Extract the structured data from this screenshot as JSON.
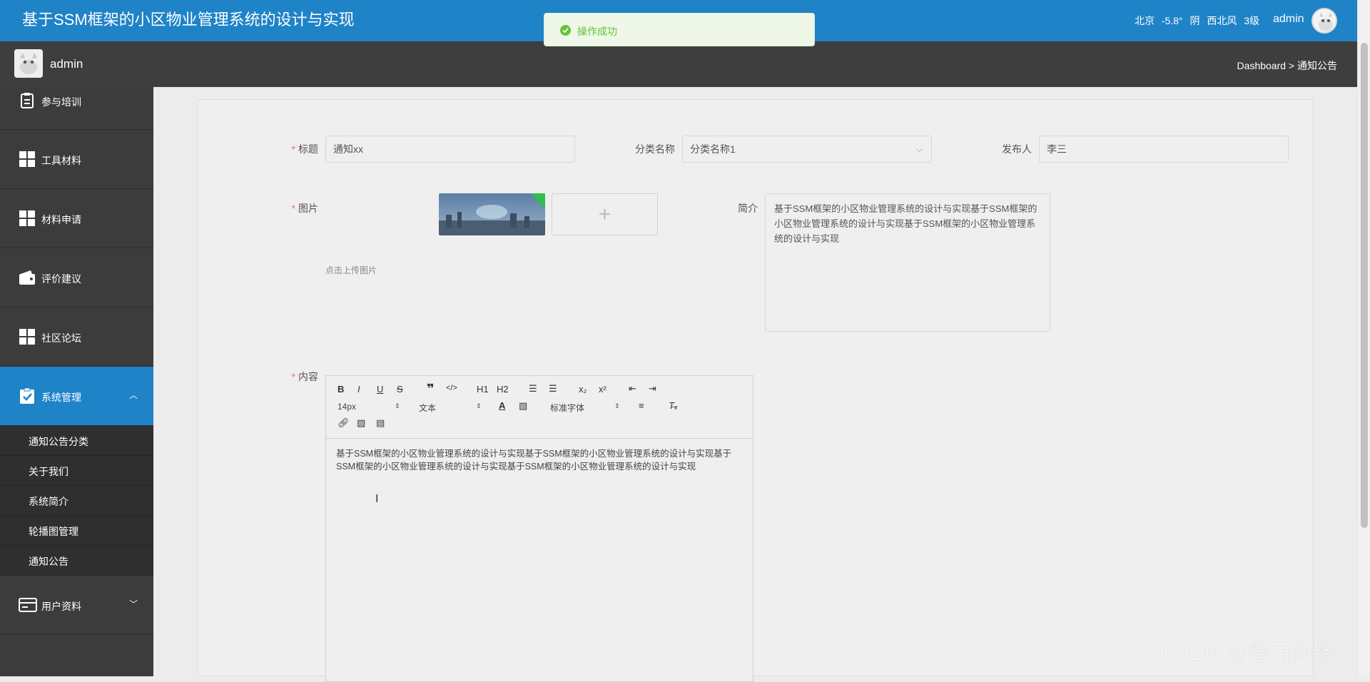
{
  "header": {
    "app_title": "基于SSM框架的小区物业管理系统的设计与实现",
    "weather": "北京  -5.8°  阴  西北风  3级",
    "username": "admin"
  },
  "subheader": {
    "username": "admin",
    "breadcrumb": "Dashboard > 通知公告"
  },
  "toast": {
    "message": "操作成功"
  },
  "sidebar": {
    "items": [
      {
        "label": "参与培训",
        "icon": "clipboard-icon"
      },
      {
        "label": "工具材料",
        "icon": "grid-icon"
      },
      {
        "label": "材料申请",
        "icon": "grid-icon"
      },
      {
        "label": "评价建议",
        "icon": "wallet-icon"
      },
      {
        "label": "社区论坛",
        "icon": "grid-icon"
      },
      {
        "label": "系统管理",
        "icon": "checklist-icon",
        "expanded": true,
        "active": true
      },
      {
        "label": "用户资料",
        "icon": "card-icon"
      }
    ],
    "submenu": [
      "通知公告分类",
      "关于我们",
      "系统简介",
      "轮播图管理",
      "通知公告"
    ]
  },
  "form": {
    "title_label": "标题",
    "title_value": "通知xx",
    "category_label": "分类名称",
    "category_value": "分类名称1",
    "publisher_label": "发布人",
    "publisher_value": "李三",
    "image_label": "图片",
    "upload_hint": "点击上传图片",
    "intro_label": "简介",
    "intro_value": "基于SSM框架的小区物业管理系统的设计与实现基于SSM框架的小区物业管理系统的设计与实现基于SSM框架的小区物业管理系统的设计与实现",
    "content_label": "内容",
    "content_value": "基于SSM框架的小区物业管理系统的设计与实现基于SSM框架的小区物业管理系统的设计与实现基于SSM框架的小区物业管理系统的设计与实现基于SSM框架的小区物业管理系统的设计与实现"
  },
  "editor": {
    "font_size": "14px",
    "block_type": "文本",
    "font_family": "标准字体",
    "h1": "H1",
    "h2": "H2",
    "sub": "x₂",
    "sup": "x²"
  },
  "watermark": "CSDN @磐石网络",
  "colors": {
    "accent": "#1f83c8",
    "required": "#f56c6c",
    "success": "#67c23a"
  }
}
